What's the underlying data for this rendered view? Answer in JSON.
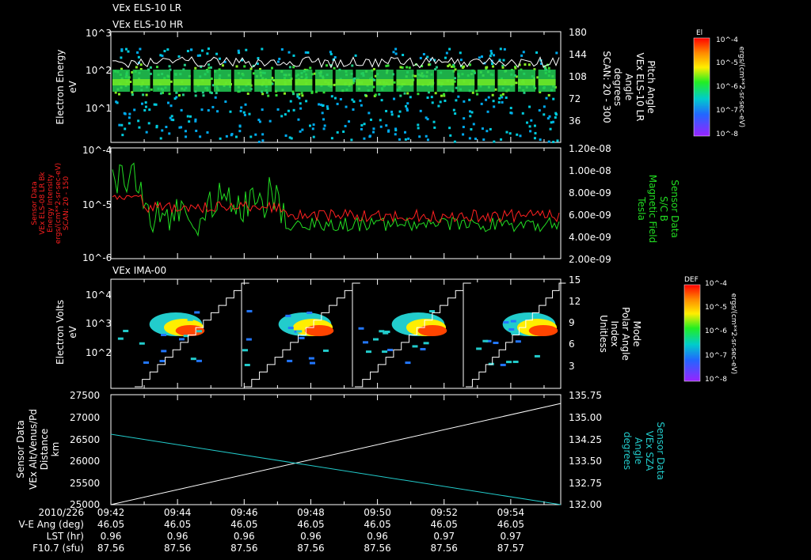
{
  "titles": {
    "line1": "VEx ELS-10 LR",
    "line2": "VEx ELS-10 HR",
    "panel3": "VEx IMA-00"
  },
  "colors": {
    "background": "#000000",
    "white": "#ffffff",
    "red": "#ff2020",
    "green": "#22dd22",
    "cyan": "#22cccc"
  },
  "chart_data": [
    {
      "type": "heatmap",
      "panel": 1,
      "ylabel": "Electron Energy eV",
      "ylabel_lines": [
        "Electron Energy",
        "eV"
      ],
      "yticks": [
        "10^3",
        "10^2",
        "10^1"
      ],
      "ylim_log": [
        0.0,
        3.0
      ],
      "right_ylabel_lines": [
        "Pitch Angle",
        "VEx ELS-10 LR",
        "Angle",
        "degrees",
        "SCAN: 20 - 300"
      ],
      "right_yticks": [
        "180",
        "144",
        "108",
        "72",
        "36"
      ],
      "right_ylim": [
        0,
        180
      ],
      "colorbar_label": "El",
      "colorbar_units": "ergs/(cm**2-sr-sec-eV)",
      "colorbar_ticks": [
        "10^-4",
        "10^-5",
        "10^-6",
        "10^-7",
        "10^-8"
      ],
      "overlay": "white line, pitch angle trace"
    },
    {
      "type": "line",
      "panel": 2,
      "left_ylabel_lines": [
        "Sensor Data",
        "VEx ELS-08 LR Bk",
        "Energy Intensity",
        "ergs/(cm**2-sr-sec-eV)",
        "SCAN: 20 - 150"
      ],
      "yticks": [
        "10^-4",
        "10^-5",
        "10^-6"
      ],
      "ylim_log": [
        -6,
        -4
      ],
      "right_ylabel_lines": [
        "Sensor Data",
        "S/C B",
        "Magnetic Field",
        "Tesla"
      ],
      "right_yticks": [
        "1.20e-08",
        "1.00e-08",
        "8.00e-09",
        "6.00e-09",
        "4.00e-09",
        "2.00e-09"
      ],
      "right_ylim": [
        2e-09,
        1.2e-08
      ],
      "series": [
        {
          "name": "Energy Intensity",
          "color": "#ff2020"
        },
        {
          "name": "Magnetic Field",
          "color": "#22dd22"
        }
      ]
    },
    {
      "type": "heatmap",
      "panel": 3,
      "ylabel_lines": [
        "Electron Volts",
        "eV"
      ],
      "yticks": [
        "10^4",
        "10^3",
        "10^2"
      ],
      "right_ylabel_lines": [
        "Mode",
        "Polar Angle",
        "Index",
        "Unitless"
      ],
      "right_yticks": [
        "15",
        "12",
        "9",
        "6",
        "3"
      ],
      "right_ylim": [
        0,
        15
      ],
      "colorbar_label": "DEF",
      "colorbar_units": "ergs/(cm**2-sr-sec-eV)",
      "colorbar_ticks": [
        "10^-4",
        "10^-5",
        "10^-6",
        "10^-7",
        "10^-8"
      ]
    },
    {
      "type": "line",
      "panel": 4,
      "left_ylabel_lines": [
        "Sensor Data",
        "VEx Alt/Venus/Pd",
        "Distance",
        "km"
      ],
      "yticks": [
        "27500",
        "27000",
        "26500",
        "26000",
        "25500",
        "25000"
      ],
      "ylim": [
        25000,
        27500
      ],
      "right_ylabel_lines": [
        "Sensor Data",
        "VEx SZA",
        "Angle",
        "degrees"
      ],
      "right_yticks": [
        "135.75",
        "135.00",
        "134.25",
        "133.50",
        "132.75",
        "132.00"
      ],
      "right_ylim": [
        132.0,
        135.75
      ],
      "series": [
        {
          "name": "Distance",
          "color": "#ffffff",
          "x": [
            "09:42",
            "09:55"
          ],
          "y": [
            25000,
            27300
          ]
        },
        {
          "name": "SZA",
          "color": "#22cccc",
          "x": [
            "09:42",
            "09:55"
          ],
          "y": [
            134.4,
            132.0
          ]
        }
      ]
    }
  ],
  "footer": {
    "row_labels": [
      "2010/226",
      "V-E Ang (deg)",
      "LST (hr)",
      "F10.7 (sfu)"
    ],
    "columns": [
      {
        "time": "09:42",
        "vea": "46.05",
        "lst": "0.96",
        "f107": "87.56"
      },
      {
        "time": "09:44",
        "vea": "46.05",
        "lst": "0.96",
        "f107": "87.56"
      },
      {
        "time": "09:46",
        "vea": "46.05",
        "lst": "0.96",
        "f107": "87.56"
      },
      {
        "time": "09:48",
        "vea": "46.05",
        "lst": "0.96",
        "f107": "87.56"
      },
      {
        "time": "09:50",
        "vea": "46.05",
        "lst": "0.96",
        "f107": "87.56"
      },
      {
        "time": "09:52",
        "vea": "46.05",
        "lst": "0.97",
        "f107": "87.56"
      },
      {
        "time": "09:54",
        "vea": "46.05",
        "lst": "0.97",
        "f107": "87.57"
      }
    ]
  }
}
